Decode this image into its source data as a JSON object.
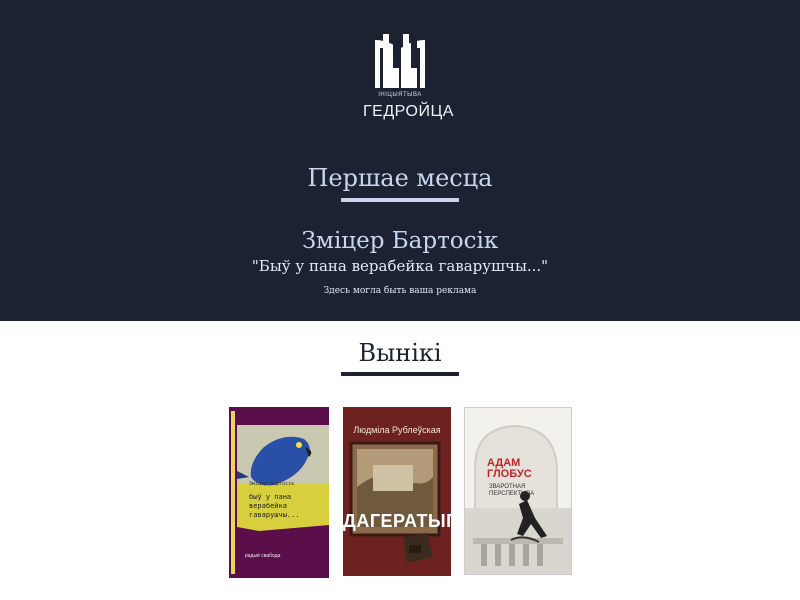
{
  "logo": {
    "small_text": "ІНІЦЫЯТЫВА",
    "big_text": "ГЕДРОЙЦА"
  },
  "hero": {
    "title": "Першае месца",
    "author": "Зміцер Бартосік",
    "book_title": "\"Быў у пана верабейка гаварушчы...\"",
    "ad_text": "Здесь могла быть ваша реклама"
  },
  "results": {
    "title": "Вынікі"
  },
  "books": [
    {
      "author": "Зміцер Бартосік",
      "title_lines": [
        "быў у пана",
        "верабейка",
        "гаварушчы..."
      ],
      "publisher": "радыё свабода",
      "icon": "parrot-illustration"
    },
    {
      "author": "Людміла Рублеўская",
      "title": "ДАГЕРАТЫП",
      "icon": "daguerreotype-painting"
    },
    {
      "author_lines": [
        "АДАМ",
        "ГЛОБУС"
      ],
      "title_lines": [
        "ЗВАРОТНАЯ",
        "ПЕРСПЕКТЫВА"
      ],
      "icon": "man-on-balustrade-illustration"
    }
  ],
  "colors": {
    "hero_bg": "#1d2232",
    "accent_light": "#c8d6ef",
    "accent_dark": "#1d2232"
  }
}
